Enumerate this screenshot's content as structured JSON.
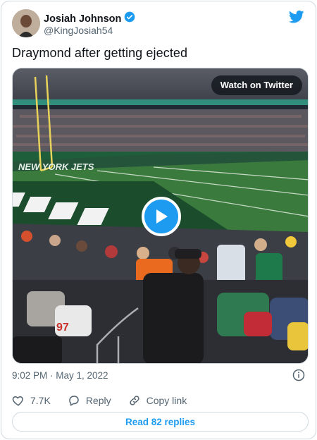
{
  "author": {
    "display_name": "Josiah Johnson",
    "handle": "@KingJosiah54",
    "verified": true
  },
  "brand": {
    "logo_icon": "twitter-bird-icon",
    "accent": "#1d9bf0"
  },
  "tweet": {
    "text": "Draymond after getting ejected",
    "timestamp": "9:02 PM · May 1, 2022"
  },
  "media": {
    "type": "video",
    "watch_label": "Watch on Twitter",
    "stadium_banner": "NEW YORK JETS"
  },
  "actions": {
    "like_count": "7.7K",
    "reply_label": "Reply",
    "copy_label": "Copy link",
    "read_replies_label": "Read 82 replies"
  }
}
